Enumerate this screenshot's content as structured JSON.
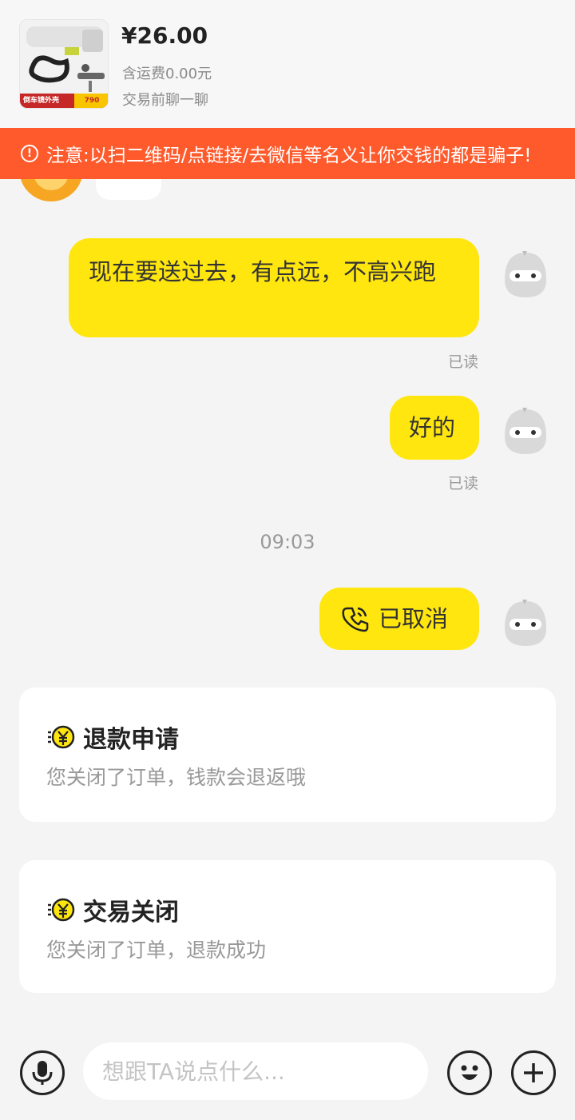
{
  "product": {
    "price": "¥26.00",
    "shipping": "含运费0.00元",
    "chat_hint": "交易前聊一聊",
    "thumbnail_caption": "倒车镜外壳",
    "thumbnail_price": "790"
  },
  "warning": {
    "text": "注意:以扫二维码/点链接/去微信等名义让你交钱的都是骗子!"
  },
  "messages": [
    {
      "text": "现在要送过去，有点远，不高兴跑",
      "status": "已读"
    },
    {
      "text": "好的",
      "status": "已读"
    },
    {
      "text": "已取消",
      "icon": "phone-icon"
    }
  ],
  "timestamp": "09:03",
  "cards": [
    {
      "title": "退款申请",
      "desc": "您关闭了订单，钱款会退返哦",
      "icon": "yuan-coin-icon"
    },
    {
      "title": "交易关闭",
      "desc": "您关闭了订单，退款成功",
      "icon": "yuan-coin-icon"
    }
  ],
  "input": {
    "placeholder": "想跟TA说点什么..."
  },
  "colors": {
    "accent": "#ffe60f",
    "warning": "#ff5a2c",
    "background": "#f4f4f4"
  }
}
